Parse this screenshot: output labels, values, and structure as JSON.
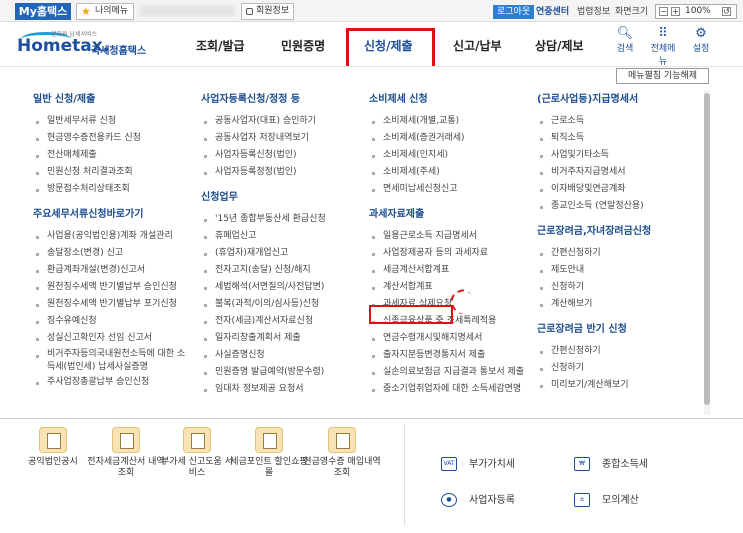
{
  "topbar": {
    "my_home": "My홈택스",
    "my_menu": "나의메뉴",
    "user_info": "회원정보",
    "logout": "로그아웃",
    "contact_center": "연중센터",
    "law_info": "법령정보",
    "screen_size": "화면크기",
    "zoom": "100%"
  },
  "logo": {
    "small_text": "전자원 납세서비스",
    "name": "Hometax.",
    "org": "국세청홈택스"
  },
  "nav": {
    "items": [
      "조회/발급",
      "민원증명",
      "신청/제출",
      "신고/납부",
      "상담/제보"
    ],
    "active": "신청/제출",
    "search": "검색",
    "all_menu": "전체메뉴",
    "settings": "설정"
  },
  "menu_release": "메뉴펼침 기능해제",
  "columns": [
    {
      "sections": [
        {
          "title": "일반 신청/제출",
          "items": [
            "일반세무서류 신청",
            "현금영수증전용카드 신청",
            "전산매체제출",
            "민원신청 처리결과조회",
            "방문접수처리상태조회"
          ]
        },
        {
          "title": "주요세무서류신청바로가기",
          "items": [
            "사업용(공익법인용)계좌 개설관리",
            "송달장소(변경) 신고",
            "환급계좌개설(변경)신고서",
            "원천징수세액 반기별납부 승인신청",
            "원천징수세액 반기별납부 포기신청",
            "징수유예신청",
            "성실신고확인자 선임 신고서",
            "비거주자등의국내원천소득에 대한 소득세(법인세) 납세사실증명",
            "주사업장총괄납부 승인신청"
          ]
        }
      ]
    },
    {
      "sections": [
        {
          "title": "사업자등록신청/정정 등",
          "items": [
            "공동사업자(대표) 승인하기",
            "공동사업자 저장내역보기",
            "사업자등록신청(법인)",
            "사업자등록정정(법인)"
          ]
        },
        {
          "title": "신청업무",
          "items": [
            "'15년 종합부동산세 환급신청",
            "휴폐업신고",
            "(휴업자)재개업신고",
            "전자고지(송달) 신청/해지",
            "세법해석(서면질의/사전답변)",
            "불복(과적/이의/심사등)신청",
            "전자(세금)계산서자료신청",
            "일자리창출계획서 제출",
            "사실증명신청",
            "민원증명 발급예약(방문수령)",
            "임대차 정보제공 요청서"
          ]
        }
      ]
    },
    {
      "sections": [
        {
          "title": "소비제세 신청",
          "items": [
            "소비제세(개별,교통)",
            "소비제세(증권거래세)",
            "소비제세(인지세)",
            "소비제세(주세)",
            "면세미납세신청신고"
          ]
        },
        {
          "title": "과세자료제출",
          "items": [
            "일용근로소득 지급명세서",
            "사업장제공자 등의 과세자료",
            "세금계산서합계표",
            "계산서합계표",
            "과세자료 삭제요청",
            "신종금융상품 중 조세특례적용",
            "연금수령개시및해지명세서",
            "출자지분등변경통지서 제출",
            "실손의료보험금 지급결과 통보서 제출",
            "중소기업취업자에 대한 소득세감면명"
          ]
        }
      ]
    },
    {
      "sections": [
        {
          "title": "(근로사업등)지급명세서",
          "items": [
            "근로소득",
            "퇴직소득",
            "사업및기타소득",
            "비거주자지급명세서",
            "이자배당및연금계좌",
            "종교인소득 (연말정산용)"
          ]
        },
        {
          "title": "근로장려금,자녀장려금신청",
          "items": [
            "간편신청하기",
            "제도안내",
            "신청하기",
            "계산해보기"
          ]
        },
        {
          "title": "근로장려금 반기 신청",
          "items": [
            "간편신청하기",
            "신청하기",
            "미리보기/계산해보기"
          ]
        }
      ]
    }
  ],
  "quick": [
    {
      "label": "공익법인공시",
      "icon": "building-icon"
    },
    {
      "label": "전자세금계산서 내역조회",
      "icon": "invoice-icon"
    },
    {
      "label": "부가세 신고도움 서비스",
      "icon": "vat-icon"
    },
    {
      "label": "세금포인트 할인쇼핑몰",
      "icon": "point-icon"
    },
    {
      "label": "현금영수증 매입내역 조회",
      "icon": "receipt-icon"
    }
  ],
  "right_quick": [
    {
      "label": "부가가치세",
      "icon": "vat-icon"
    },
    {
      "label": "종합소득세",
      "icon": "coins-icon"
    },
    {
      "label": "사업자등록",
      "icon": "person-icon"
    },
    {
      "label": "모의계산",
      "icon": "calculator-icon"
    }
  ]
}
